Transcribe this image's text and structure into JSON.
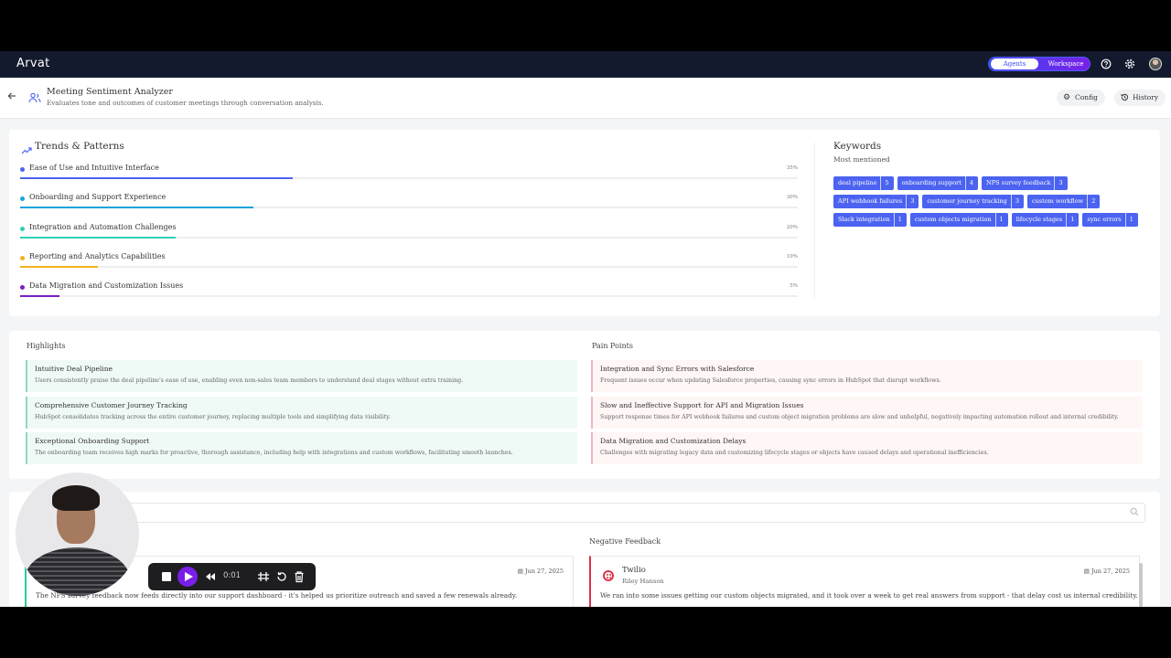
{
  "app": {
    "logo": "Arvat"
  },
  "nav": {
    "toggle": {
      "active": "Agents",
      "inactive": "Workspace"
    }
  },
  "header": {
    "title": "Meeting Sentiment Analyzer",
    "subtitle": "Evaluates tone and outcomes of customer meetings through conversation analysis.",
    "config_label": "Config",
    "history_label": "History"
  },
  "trends": {
    "title": "Trends & Patterns",
    "items": [
      {
        "label": "Ease of Use and Intuitive Interface",
        "percent": "35%",
        "value": 35,
        "color": "#4b63f0"
      },
      {
        "label": "Onboarding and Support Experience",
        "percent": "30%",
        "value": 30,
        "color": "#1aa3dc"
      },
      {
        "label": "Integration and Automation Challenges",
        "percent": "20%",
        "value": 20,
        "color": "#2ed0b4"
      },
      {
        "label": "Reporting and Analytics Capabilities",
        "percent": "10%",
        "value": 10,
        "color": "#f2b21b"
      },
      {
        "label": "Data Migration and Customization Issues",
        "percent": "5%",
        "value": 5,
        "color": "#7a1fc2"
      }
    ]
  },
  "keywords": {
    "title": "Keywords",
    "subtitle": "Most mentioned",
    "chips": [
      {
        "label": "deal pipeline",
        "count": "5"
      },
      {
        "label": "onboarding support",
        "count": "4"
      },
      {
        "label": "NPS survey feedback",
        "count": "3"
      },
      {
        "label": "API webhook failures",
        "count": "3"
      },
      {
        "label": "customer journey tracking",
        "count": "3"
      },
      {
        "label": "custom workflow",
        "count": "2"
      },
      {
        "label": "Slack integration",
        "count": "1"
      },
      {
        "label": "custom objects migration",
        "count": "1"
      },
      {
        "label": "lifecycle stages",
        "count": "1"
      },
      {
        "label": "sync errors",
        "count": "1"
      }
    ]
  },
  "highlights": {
    "title": "Highlights",
    "items": [
      {
        "title": "Intuitive Deal Pipeline",
        "desc": "Users consistently praise the deal pipeline's ease of use, enabling even non-sales team members to understand deal stages without extra training."
      },
      {
        "title": "Comprehensive Customer Journey Tracking",
        "desc": "HubSpot consolidates tracking across the entire customer journey, replacing multiple tools and simplifying data visibility."
      },
      {
        "title": "Exceptional Onboarding Support",
        "desc": "The onboarding team receives high marks for proactive, thorough assistance, including help with integrations and custom workflows, facilitating smooth launches."
      }
    ]
  },
  "pain_points": {
    "title": "Pain Points",
    "items": [
      {
        "title": "Integration and Sync Errors with Salesforce",
        "desc": "Frequent issues occur when updating Salesforce properties, causing sync errors in HubSpot that disrupt workflows."
      },
      {
        "title": "Slow and Ineffective Support for API and Migration Issues",
        "desc": "Support response times for API webhook failures and custom object migration problems are slow and unhelpful, negatively impacting automation rollout and internal credibility."
      },
      {
        "title": "Data Migration and Customization Delays",
        "desc": "Challenges with migrating legacy data and customizing lifecycle stages or objects have caused delays and operational inefficiencies."
      }
    ]
  },
  "feedback": {
    "negative_title": "Negative Feedback",
    "positive_card": {
      "date": "Jun 27, 2025",
      "text": "The NPS survey feedback now feeds directly into our support dashboard - it's helped us prioritize outreach and saved a few renewals already."
    },
    "negative_card": {
      "company": "Twilio",
      "person": "Riley Hanson",
      "date": "Jun 27, 2025",
      "text": "We ran into some issues getting our custom objects migrated, and it took over a week to get real answers from support - that delay cost us internal credibility."
    }
  },
  "recorder": {
    "time": "0:01"
  },
  "colors": {
    "accent": "#4b63f0",
    "nav_bg": "#141a2e",
    "positive_border": "#2ec9a0",
    "negative_border": "#e0314b"
  }
}
